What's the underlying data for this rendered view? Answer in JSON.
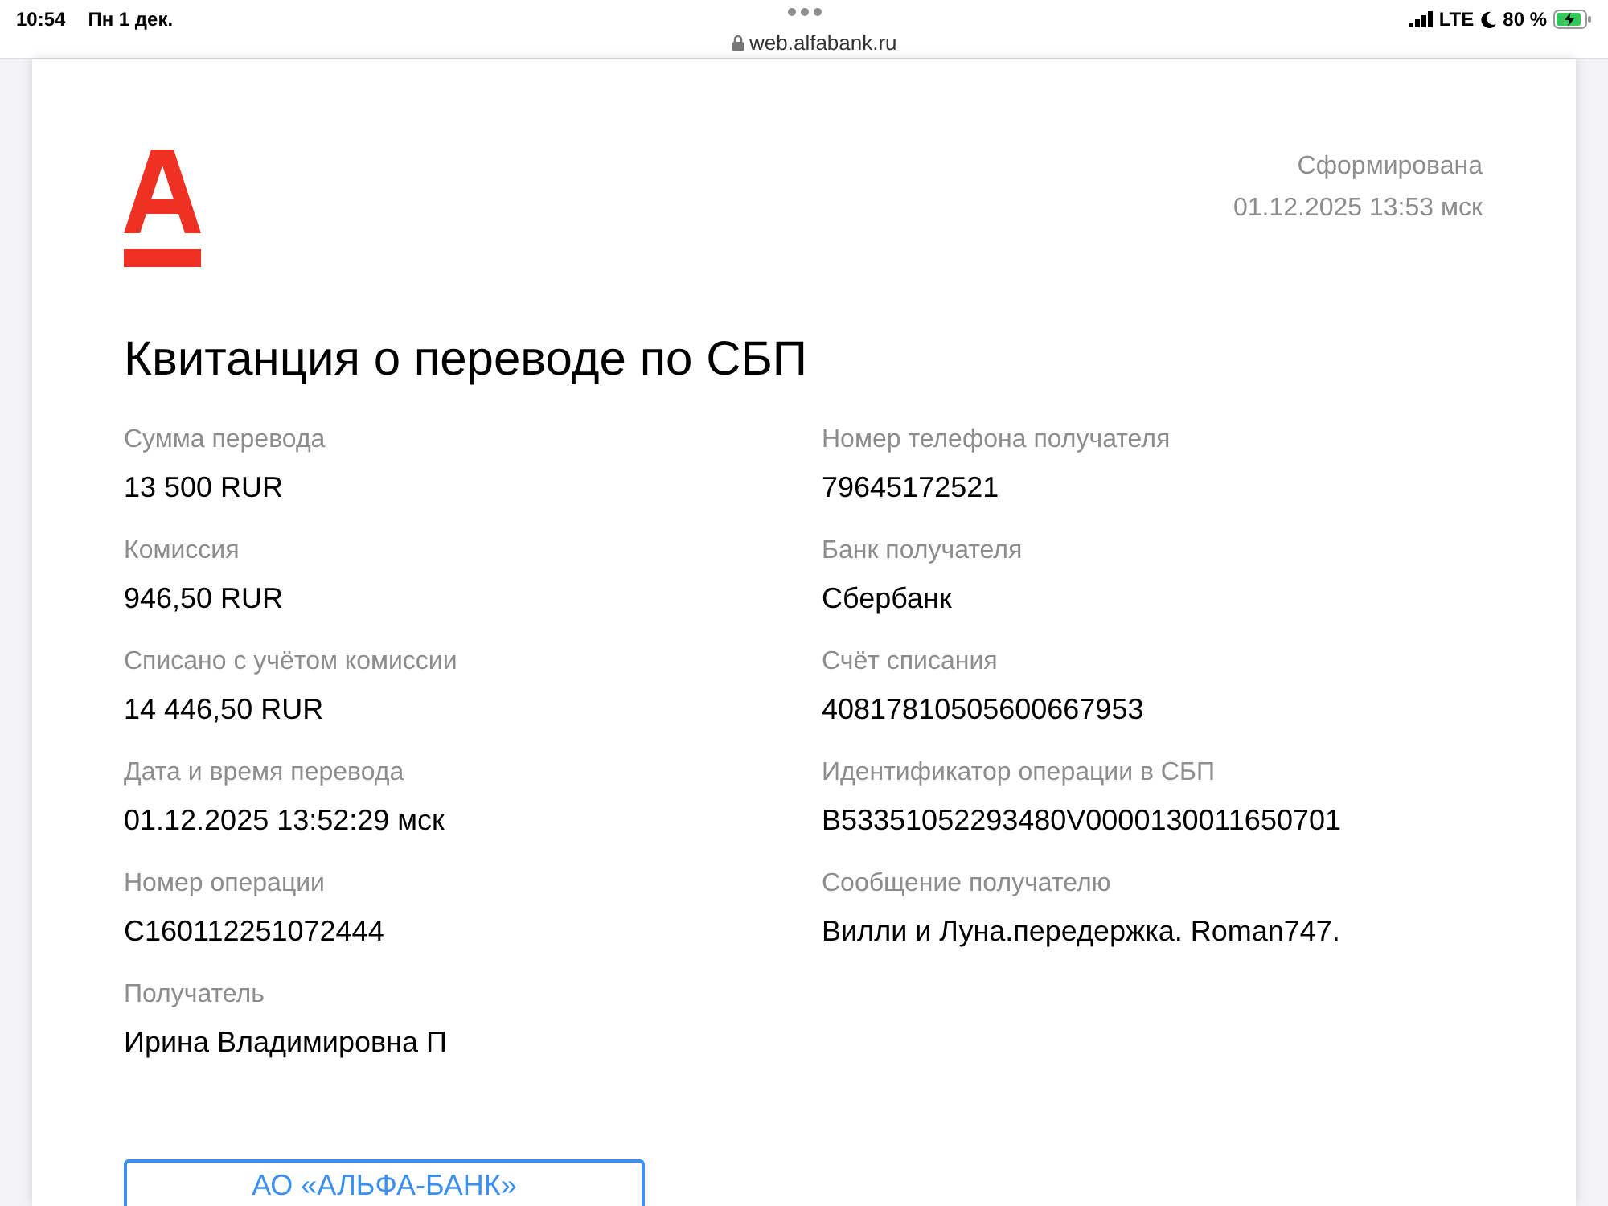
{
  "status_bar": {
    "time": "10:54",
    "date": "Пн 1 дек.",
    "network": "LTE",
    "battery": "80 %"
  },
  "address_bar": {
    "url": "web.alfabank.ru"
  },
  "receipt": {
    "generated_label": "Сформирована",
    "generated_at": "01.12.2025 13:53 мск",
    "title": "Квитанция о переводе по СБП",
    "left_fields": [
      {
        "label": "Сумма перевода",
        "value": "13 500 RUR"
      },
      {
        "label": "Комиссия",
        "value": "946,50 RUR"
      },
      {
        "label": "Списано с учётом комиссии",
        "value": "14 446,50 RUR"
      },
      {
        "label": "Дата и время перевода",
        "value": "01.12.2025 13:52:29 мск"
      },
      {
        "label": "Номер операции",
        "value": "C160112251072444"
      },
      {
        "label": "Получатель",
        "value": "Ирина Владимировна П"
      }
    ],
    "right_fields": [
      {
        "label": "Номер телефона получателя",
        "value": "79645172521"
      },
      {
        "label": "Банк получателя",
        "value": "Сбербанк"
      },
      {
        "label": "Счёт списания",
        "value": "40817810505600667953"
      },
      {
        "label": "Идентификатор операции в СБП",
        "value": "B53351052293480V0000130011650701"
      },
      {
        "label": "Сообщение получателю",
        "value": "Вилли и Луна.передержка. Roman747."
      }
    ],
    "stamp": "АО «АЛЬФА-БАНК»"
  }
}
